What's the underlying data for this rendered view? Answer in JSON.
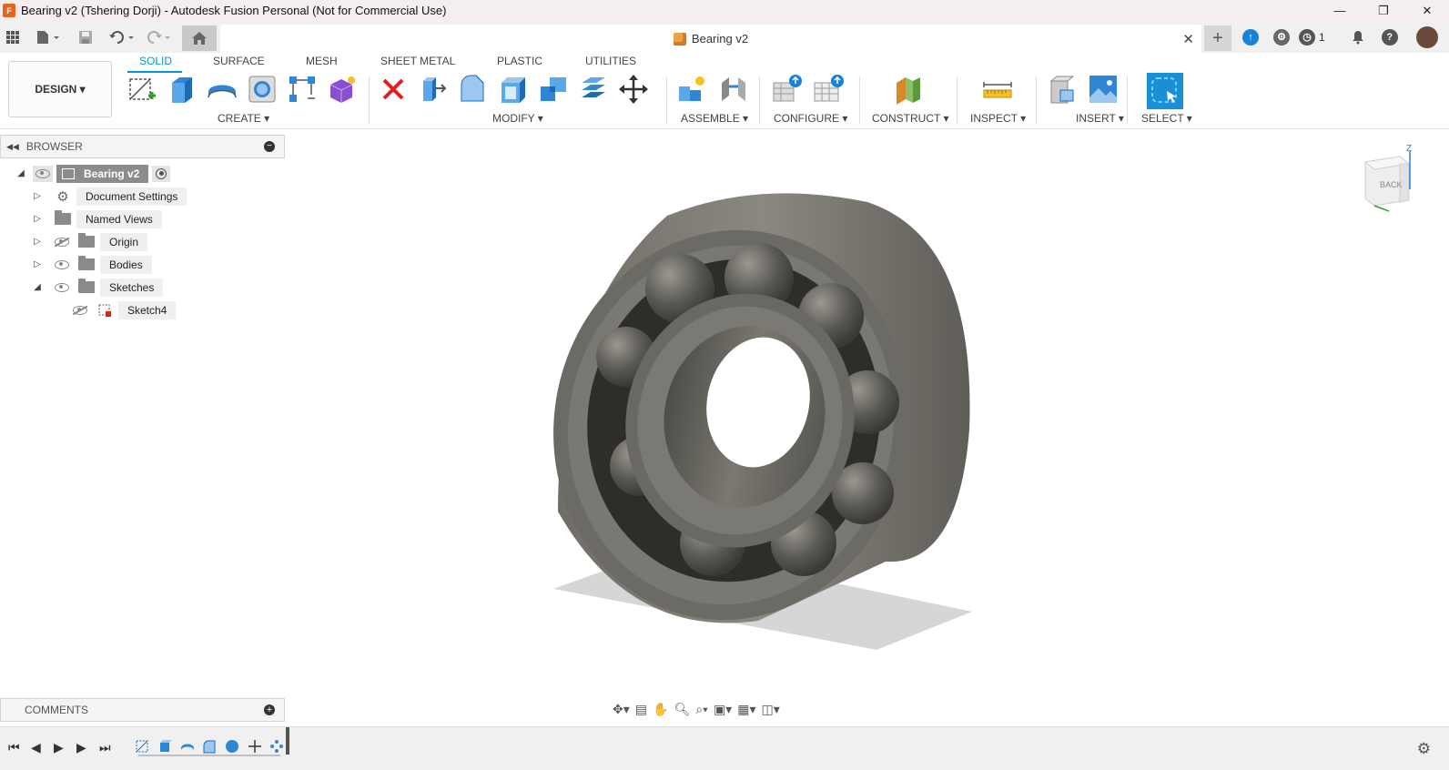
{
  "window": {
    "title": "Bearing v2 (Tshering Dorji) - Autodesk Fusion Personal (Not for Commercial Use)",
    "logo_letter": "F",
    "minimize": "—",
    "restore": "❐",
    "close": "✕"
  },
  "document_tab": {
    "name": "Bearing v2",
    "close": "✕"
  },
  "header": {
    "job_count": "1"
  },
  "workspace": {
    "label": "DESIGN ▾"
  },
  "ribbon": {
    "tabs": [
      "SOLID",
      "SURFACE",
      "MESH",
      "SHEET METAL",
      "PLASTIC",
      "UTILITIES"
    ],
    "groups": [
      "CREATE ▾",
      "MODIFY ▾",
      "ASSEMBLE ▾",
      "CONFIGURE ▾",
      "CONSTRUCT ▾",
      "INSPECT ▾",
      "INSERT ▾",
      "SELECT ▾"
    ]
  },
  "browser": {
    "title": "BROWSER",
    "root": "Bearing v2",
    "items": [
      "Document Settings",
      "Named Views",
      "Origin",
      "Bodies",
      "Sketches",
      "Sketch4"
    ]
  },
  "comments": {
    "title": "COMMENTS"
  },
  "viewcube": {
    "face": "BACK",
    "axis_z": "Z"
  },
  "colors": {
    "accent": "#0696d7",
    "titlebar": "#f5eef0",
    "delete_red": "#e0201c"
  }
}
